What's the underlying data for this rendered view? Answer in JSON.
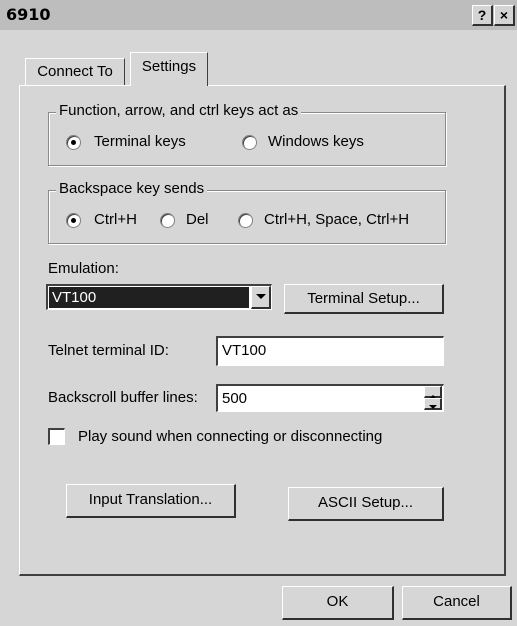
{
  "window": {
    "title": "6910",
    "help_glyph": "?",
    "close_glyph": "×"
  },
  "tabs": [
    {
      "label": "Connect To"
    },
    {
      "label": "Settings"
    }
  ],
  "function_keys": {
    "legend": "Function, arrow, and ctrl keys act as",
    "options": [
      {
        "label": "Terminal keys",
        "selected": true
      },
      {
        "label": "Windows keys",
        "selected": false
      }
    ]
  },
  "backspace": {
    "legend": "Backspace key sends",
    "options": [
      {
        "label": "Ctrl+H",
        "selected": true
      },
      {
        "label": "Del",
        "selected": false
      },
      {
        "label": "Ctrl+H, Space, Ctrl+H",
        "selected": false
      }
    ]
  },
  "emulation": {
    "label": "Emulation:",
    "value": "VT100",
    "setup_button": "Terminal Setup..."
  },
  "telnet": {
    "label": "Telnet terminal ID:",
    "value": "VT100"
  },
  "backscroll": {
    "label": "Backscroll buffer lines:",
    "value": "500"
  },
  "sound": {
    "label": "Play sound when connecting or disconnecting",
    "checked": false
  },
  "buttons": {
    "input_translation": "Input Translation...",
    "ascii_setup": "ASCII Setup...",
    "ok": "OK",
    "cancel": "Cancel"
  },
  "icons": [
    "help-icon",
    "close-icon",
    "dropdown-arrow-icon",
    "spin-up-icon",
    "spin-down-icon"
  ]
}
